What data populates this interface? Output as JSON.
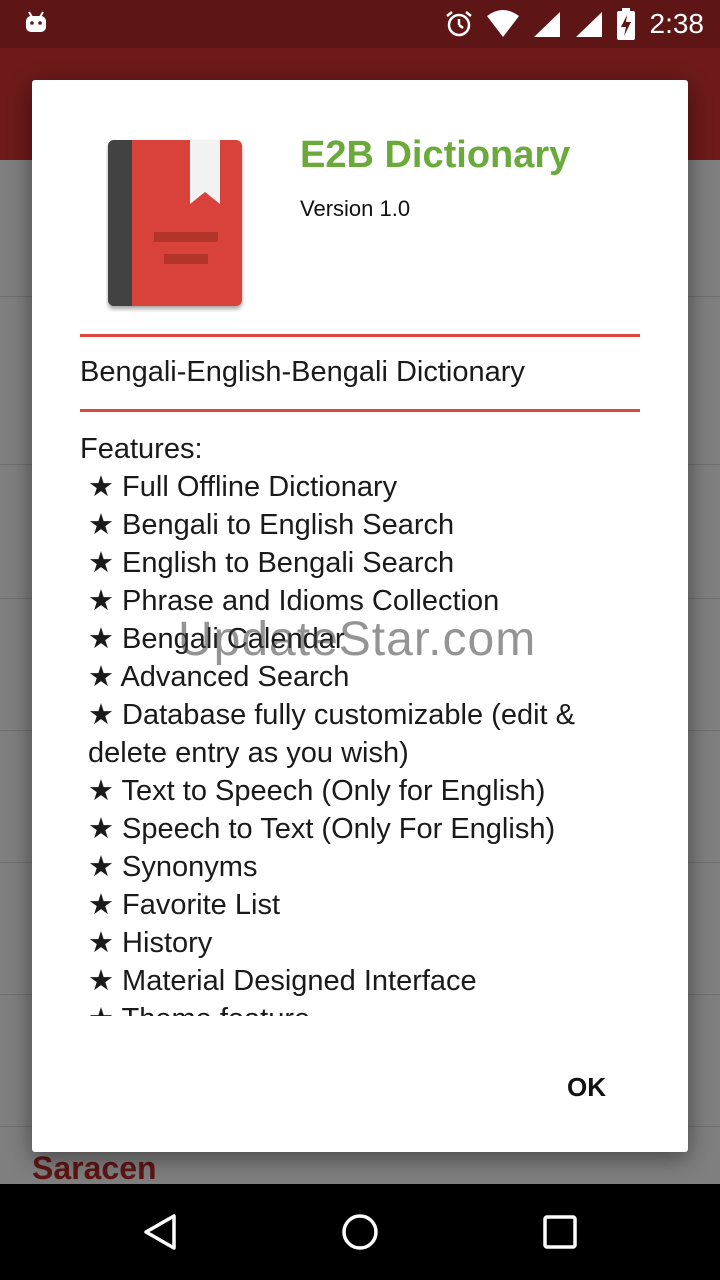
{
  "status_bar": {
    "time": "2:38",
    "icons": [
      "android-debug-icon",
      "alarm-icon",
      "wifi-icon",
      "signal-icon",
      "signal-icon",
      "battery-charging-icon"
    ]
  },
  "background": {
    "visible_word": "Saracen"
  },
  "dialog": {
    "app_name": "E2B Dictionary",
    "version": "Version 1.0",
    "subtitle": "Bengali-English-Bengali Dictionary",
    "features_heading": "Features:",
    "features": [
      "★ Full Offline Dictionary",
      "★ Bengali to English Search",
      "★ English to Bengali Search",
      "★ Phrase and Idioms Collection",
      "★ Bengali Calendar",
      "★ Advanced Search",
      "★ Database fully customizable (edit & delete entry as you wish)",
      "★ Text to Speech (Only for English)",
      "★ Speech to Text (Only For English)",
      "★ Synonyms",
      "★ Favorite List",
      "★ History",
      "★ Material Designed Interface",
      "★ Theme feature"
    ],
    "watermark": "UpdateStar.com",
    "ok_label": "OK"
  },
  "nav_bar": {
    "icons": [
      "back-icon",
      "home-icon",
      "recents-icon"
    ]
  },
  "colors": {
    "status_bar": "#5e1515",
    "accent_green": "#6aaa3a",
    "divider_red": "#e0473c",
    "icon_red": "#d9433a"
  }
}
